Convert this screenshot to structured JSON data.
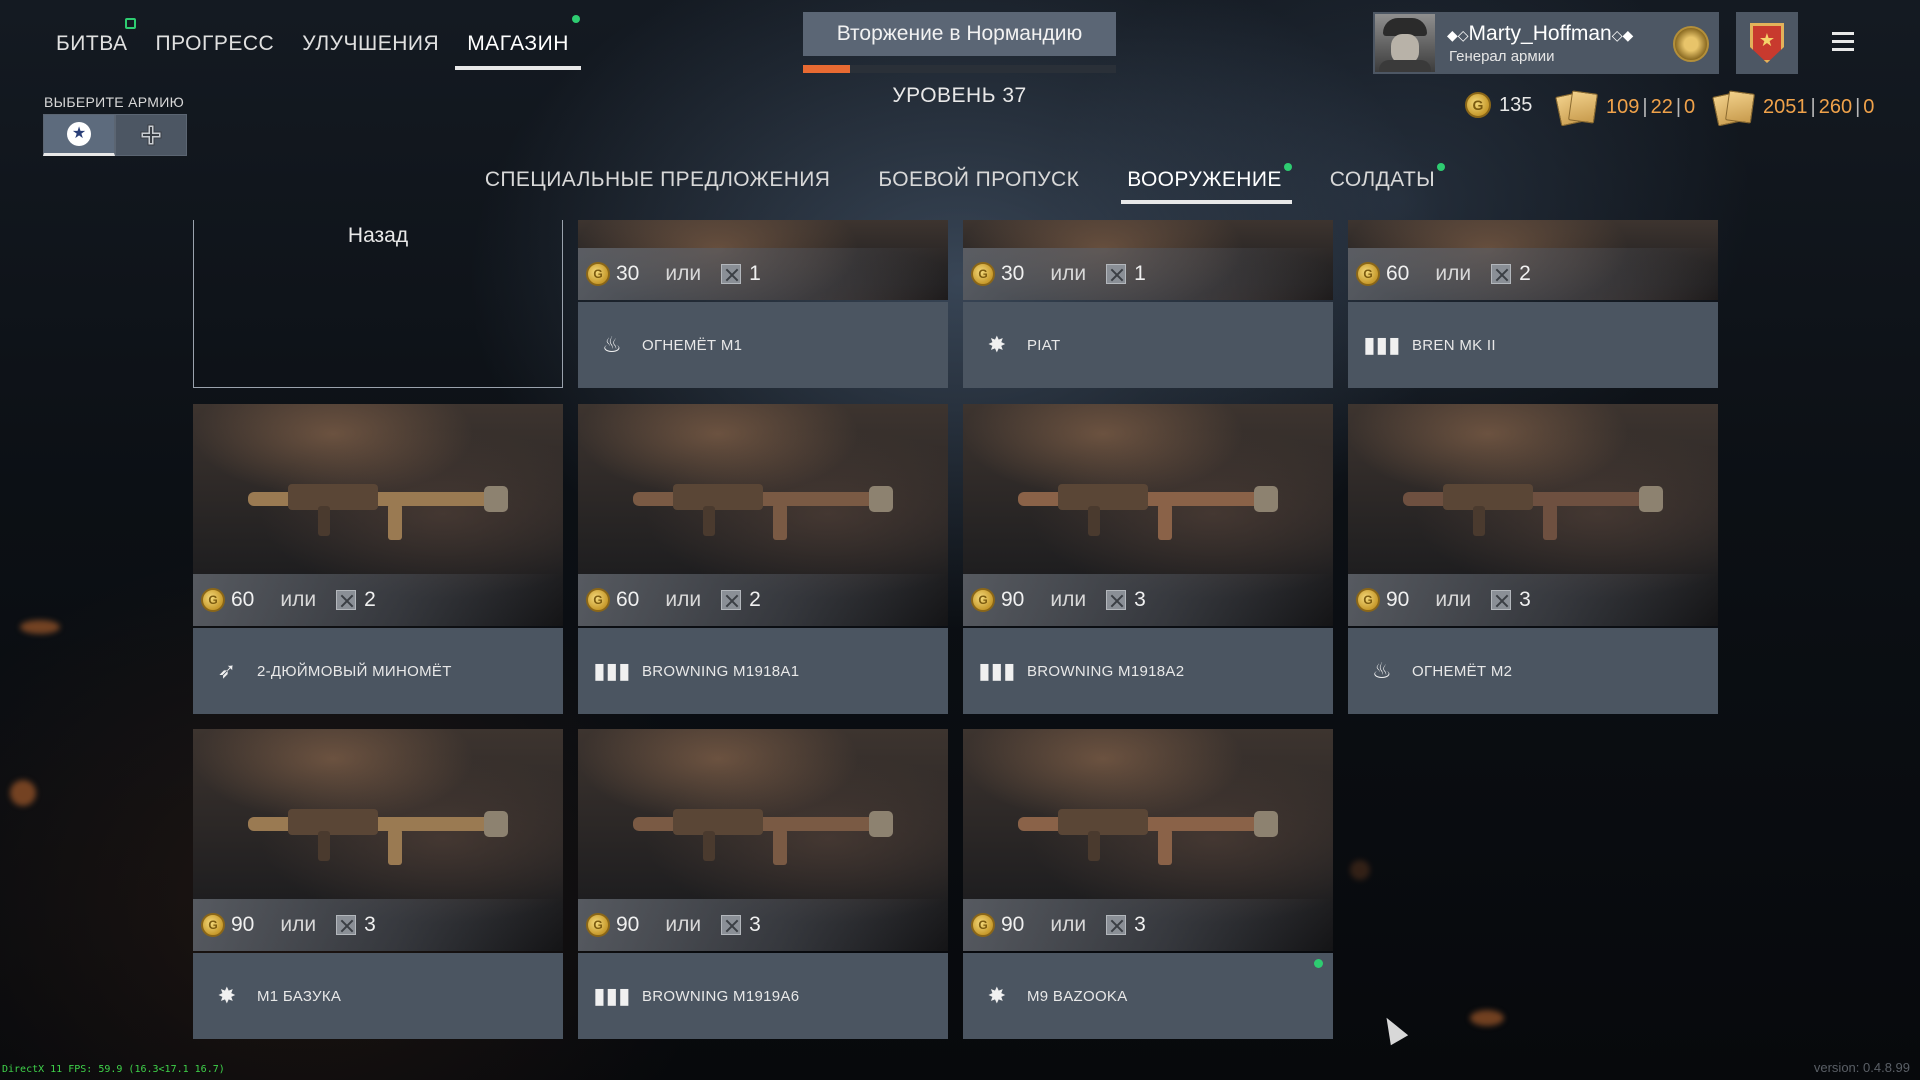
{
  "topnav": [
    {
      "label": "БИТВА",
      "active": false,
      "badge": "box"
    },
    {
      "label": "ПРОГРЕСС",
      "active": false
    },
    {
      "label": "УЛУЧШЕНИЯ",
      "active": false
    },
    {
      "label": "МАГАЗИН",
      "active": true,
      "badge": "dot"
    }
  ],
  "army": {
    "label": "ВЫБЕРИТЕ АРМИЮ",
    "options": [
      "star-icon",
      "cross-icon"
    ],
    "selected": 0
  },
  "mission": {
    "title": "Вторжение в Нормандию",
    "progress": 0.15,
    "level": "УРОВЕНЬ 37"
  },
  "profile": {
    "name": "Marty_Hoffman",
    "rank": "Генерал армии"
  },
  "currency": {
    "gold": "135",
    "tickets1": {
      "a": "109",
      "b": "22",
      "c": "0"
    },
    "tickets2": {
      "a": "2051",
      "b": "260",
      "c": "0"
    }
  },
  "tabs": [
    {
      "label": "СПЕЦИАЛЬНЫЕ ПРЕДЛОЖЕНИЯ",
      "active": false,
      "dot": false
    },
    {
      "label": "БОЕВОЙ ПРОПУСК",
      "active": false,
      "dot": false
    },
    {
      "label": "ВООРУЖЕНИЕ",
      "active": true,
      "dot": true
    },
    {
      "label": "СОЛДАТЫ",
      "active": false,
      "dot": true
    }
  ],
  "back_label": "Назад",
  "or_label": "или",
  "items": [
    {
      "name": "ОГНЕМЁТ M1",
      "gold": "30",
      "tickets": "1",
      "icon": "flame-icon",
      "row": 0,
      "col": 1
    },
    {
      "name": "PIAT",
      "gold": "30",
      "tickets": "1",
      "icon": "explosion-icon",
      "row": 0,
      "col": 2
    },
    {
      "name": "BREN MK II",
      "gold": "60",
      "tickets": "2",
      "icon": "ammo-icon",
      "row": 0,
      "col": 3
    },
    {
      "name": "2-ДЮЙМОВЫЙ МИНОМЁТ",
      "gold": "60",
      "tickets": "2",
      "icon": "mortar-icon",
      "row": 1,
      "col": 0
    },
    {
      "name": "BROWNING M1918A1",
      "gold": "60",
      "tickets": "2",
      "icon": "ammo-icon",
      "row": 1,
      "col": 1
    },
    {
      "name": "BROWNING M1918A2",
      "gold": "90",
      "tickets": "3",
      "icon": "ammo-icon",
      "row": 1,
      "col": 2
    },
    {
      "name": "ОГНЕМЁТ M2",
      "gold": "90",
      "tickets": "3",
      "icon": "flame-icon",
      "row": 1,
      "col": 3
    },
    {
      "name": "M1 БАЗУКА",
      "gold": "90",
      "tickets": "3",
      "icon": "explosion-icon",
      "row": 2,
      "col": 0
    },
    {
      "name": "BROWNING M1919A6",
      "gold": "90",
      "tickets": "3",
      "icon": "ammo-icon",
      "row": 2,
      "col": 1
    },
    {
      "name": "M9 BAZOOKA",
      "gold": "90",
      "tickets": "3",
      "icon": "explosion-icon",
      "row": 2,
      "col": 2,
      "new": true
    }
  ],
  "footer": {
    "fps": "DirectX 11 FPS: 59.9 (16.3<17.1 16.7)",
    "version": "version: 0.4.8.99"
  },
  "colors": {
    "accent": "#e86a32",
    "new": "#2ecc71",
    "panel": "#4b5561",
    "gold": "#c79a2c"
  }
}
